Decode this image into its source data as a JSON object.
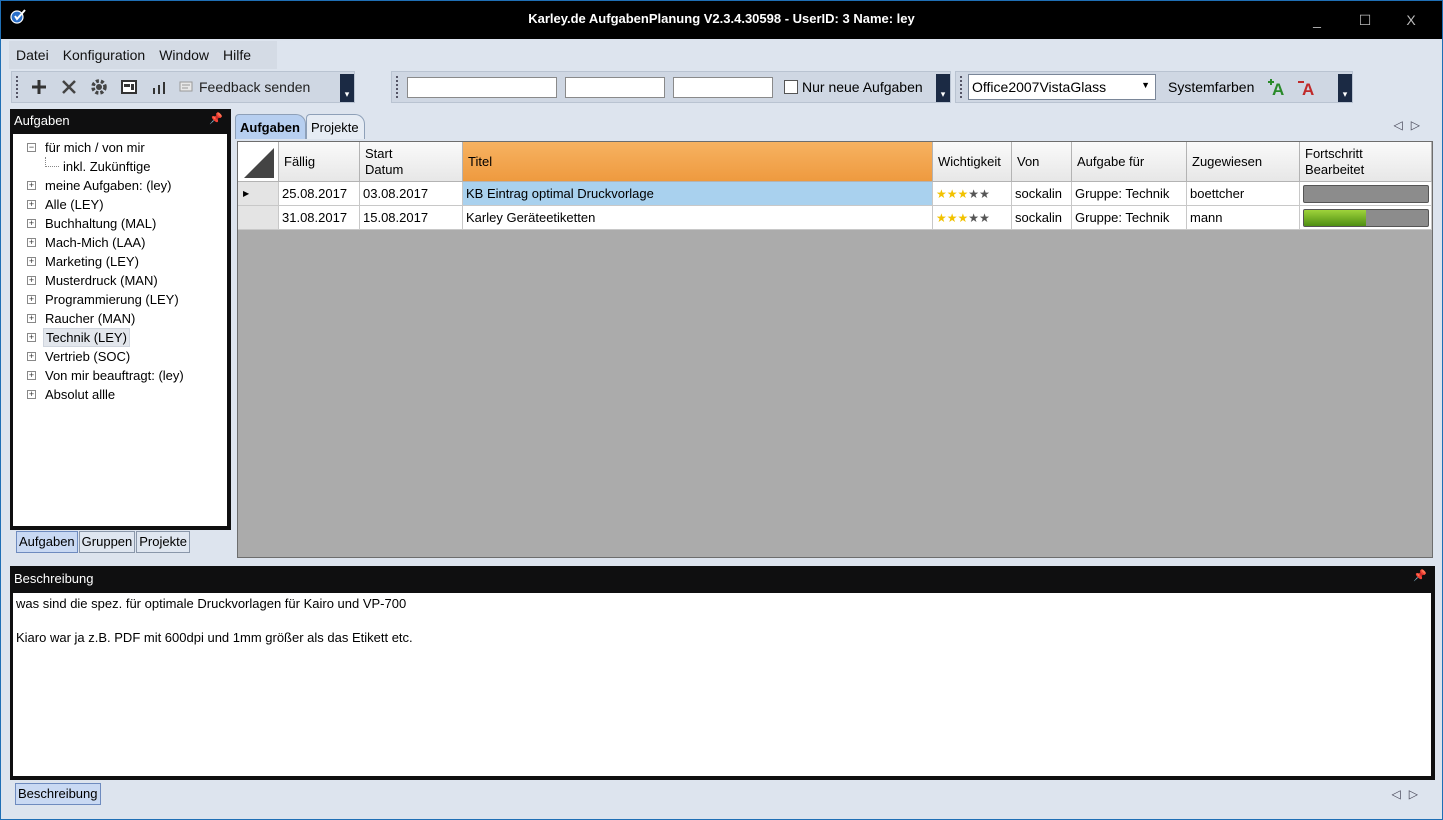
{
  "window": {
    "title": "Karley.de AufgabenPlanung V2.3.4.30598 - UserID: 3 Name: ley",
    "controls": {
      "minimize": "_",
      "maximize": "☐",
      "close": "X"
    }
  },
  "menu": [
    "Datei",
    "Konfiguration",
    "Window",
    "Hilfe"
  ],
  "toolbar1": {
    "feedback_label": "Feedback senden"
  },
  "toolbar2": {
    "input1": "",
    "input2": "",
    "input3": "",
    "checkbox_label": "Nur neue Aufgaben",
    "checkbox_checked": false
  },
  "toolbar3": {
    "theme_value": "Office2007VistaGlass",
    "systemfarben_label": "Systemfarben"
  },
  "left_panel": {
    "title": "Aufgaben",
    "tree": [
      {
        "label": "für mich / von mir",
        "expander": "−"
      },
      {
        "label": "inkl. Zukünftige",
        "expander": ""
      },
      {
        "label": "meine Aufgaben: (ley)",
        "expander": "+"
      },
      {
        "label": "Alle (LEY)",
        "expander": "+"
      },
      {
        "label": "Buchhaltung (MAL)",
        "expander": "+"
      },
      {
        "label": "Mach-Mich (LAA)",
        "expander": "+"
      },
      {
        "label": "Marketing (LEY)",
        "expander": "+"
      },
      {
        "label": "Musterdruck (MAN)",
        "expander": "+"
      },
      {
        "label": "Programmierung (LEY)",
        "expander": "+"
      },
      {
        "label": "Raucher (MAN)",
        "expander": "+"
      },
      {
        "label": "Technik (LEY)",
        "expander": "+",
        "selected": true
      },
      {
        "label": "Vertrieb (SOC)",
        "expander": "+"
      },
      {
        "label": "Von mir beauftragt: (ley)",
        "expander": "+"
      },
      {
        "label": "Absolut allle",
        "expander": "+"
      }
    ],
    "bottom_tabs": [
      "Aufgaben",
      "Gruppen",
      "Projekte"
    ]
  },
  "main_tabs": [
    "Aufgaben",
    "Projekte"
  ],
  "grid": {
    "columns": [
      {
        "label": "Fällig",
        "label2": ""
      },
      {
        "label": "Start",
        "label2": "Datum"
      },
      {
        "label": "Titel",
        "label2": "",
        "sorted": true
      },
      {
        "label": "Wichtigkeit",
        "label2": ""
      },
      {
        "label": "Von",
        "label2": ""
      },
      {
        "label": "Aufgabe für",
        "label2": ""
      },
      {
        "label": "Zugewiesen",
        "label2": ""
      },
      {
        "label": "Fortschritt",
        "label2": "Bearbeitet"
      }
    ],
    "rows": [
      {
        "marker": "▶",
        "faellig": "25.08.2017",
        "start": "03.08.2017",
        "titel": "KB Eintrag optimal Druckvorlage",
        "stars": 3,
        "von": "sockalin",
        "aufgabe_fuer": "Gruppe: Technik",
        "zugewiesen": "boettcher",
        "progress": 0
      },
      {
        "marker": "",
        "faellig": "31.08.2017",
        "start": "15.08.2017",
        "titel": "Karley Geräteetiketten",
        "stars": 3,
        "von": "sockalin",
        "aufgabe_fuer": "Gruppe: Technik",
        "zugewiesen": "mann",
        "progress": 0.5
      }
    ]
  },
  "description": {
    "title": "Beschreibung",
    "lines": [
      "was sind die spez. für optimale Druckvorlagen für Kairo und VP-700",
      "",
      "Kiaro war ja z.B. PDF mit 600dpi und 1mm größer als das Etikett etc."
    ],
    "tab": "Beschreibung"
  },
  "colors": {
    "titlebar": "#000000",
    "sorted_header": "#ee9a3f",
    "selected_cell": "#a9d1ee",
    "progress_fill": "#6fb020",
    "star_filled": "#f2c200",
    "star_empty": "#555555"
  }
}
